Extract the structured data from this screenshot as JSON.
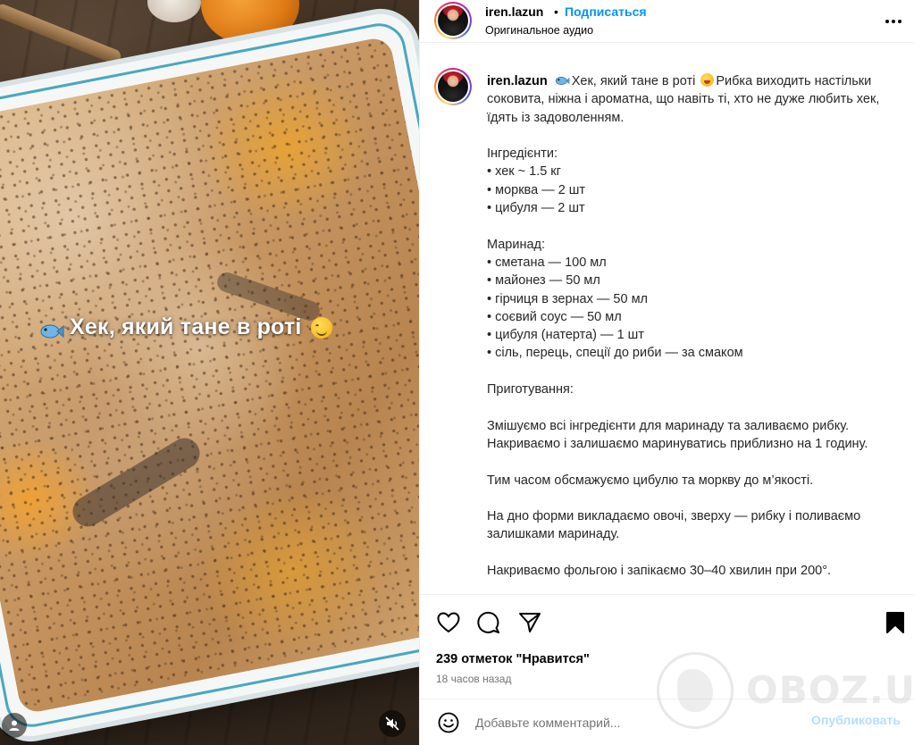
{
  "media": {
    "overlay_caption": "Хек, який тане в роті",
    "fish_emoji": "fish-emoji",
    "smile_emoji": "smiling-face-emoji"
  },
  "header": {
    "username": "iren.lazun",
    "separator": "•",
    "follow_label": "Подписаться",
    "audio_label": "Оригинальное аудио"
  },
  "caption": {
    "username": "iren.lazun",
    "intro": "Хек, який тане в роті",
    "intro_rest": "Рибка виходить настільки соковита, ніжна і ароматна, що навіть ті, хто не дуже любить хек, їдять із задоволенням.",
    "ingredients_title": "Інгредієнти:",
    "ingredients": [
      "• хек ~ 1.5 кг",
      "• морква — 2 шт",
      "• цибуля — 2 шт"
    ],
    "marinade_title": "Маринад:",
    "marinade": [
      "• сметана — 100 мл",
      "• майонез — 50 мл",
      "• гірчиця в зернах — 50 мл",
      "• соєвий соус — 50 мл",
      "• цибуля (натерта) — 1 шт",
      "• сіль, перець, спеції до риби — за смаком"
    ],
    "cooking_title": "Приготування:",
    "steps": [
      "Змішуємо всі інгредієнти для маринаду та заливаємо рибку. Накриваємо і залишаємо маринуватись приблизно на 1 годину.",
      "Тим часом обсмажуємо цибулю та моркву до м’якості.",
      "На дно форми викладаємо овочі, зверху — рибку і поливаємо залишками маринаду.",
      "Накриваємо фольгою і запікаємо 30–40 хвилин при 200°."
    ]
  },
  "actions": {
    "likes": "239 отметок \"Нравится\"",
    "time": "18 часов назад",
    "comment_placeholder": "Добавьте комментарий...",
    "post_label": "Опубликовать"
  },
  "watermark": {
    "text": "OBOZ.UA"
  },
  "colors": {
    "accent": "#0095f6",
    "post_disabled": "#b2dffc",
    "muted": "#737373"
  }
}
